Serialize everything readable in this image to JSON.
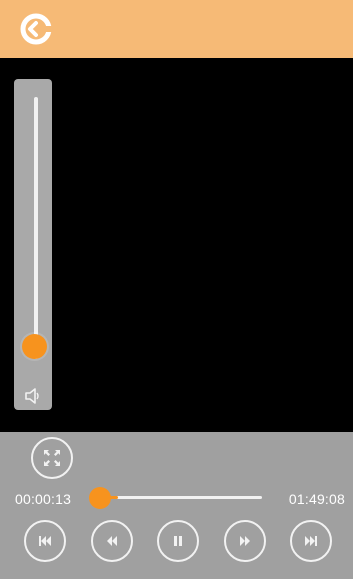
{
  "header": {
    "back_icon": "back-arrow-icon",
    "background": "#f6ba76"
  },
  "volume": {
    "level": 0.05,
    "icon": "speaker-icon"
  },
  "playback": {
    "current_time": "00:00:13",
    "total_time": "01:49:08",
    "progress": 0.0
  },
  "controls": {
    "fullscreen_icon": "fullscreen-icon",
    "buttons": [
      {
        "icon": "skip-previous-icon"
      },
      {
        "icon": "rewind-icon"
      },
      {
        "icon": "pause-icon"
      },
      {
        "icon": "fast-forward-icon"
      },
      {
        "icon": "skip-next-icon"
      }
    ]
  },
  "colors": {
    "accent": "#f7931e",
    "controls_bg": "#a0a0a0",
    "video_bg": "#000000"
  }
}
